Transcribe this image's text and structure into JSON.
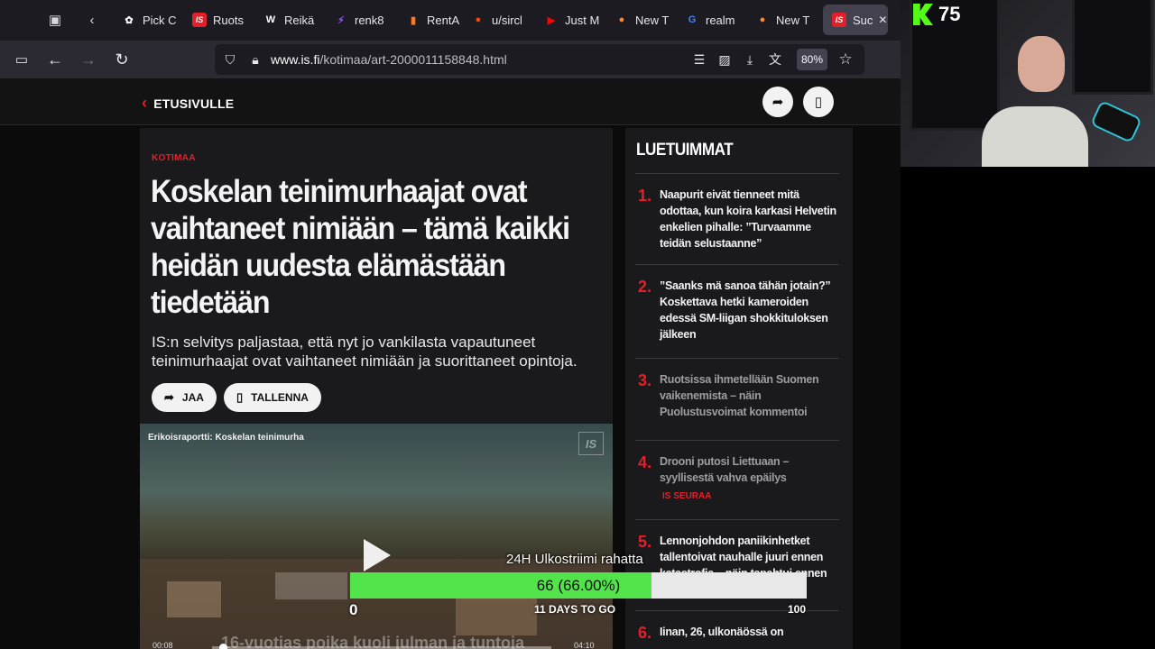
{
  "browser": {
    "tabs": [
      {
        "title": "Pick C",
        "icon": "flower-icon",
        "color": "#ffffff"
      },
      {
        "title": "Ruots",
        "icon": "is-logo-icon",
        "color": "#e3202a"
      },
      {
        "title": "Reikä",
        "icon": "wikipedia-icon",
        "color": "#ffffff"
      },
      {
        "title": "renk8",
        "icon": "bolt-icon",
        "color": "#9b4dff"
      },
      {
        "title": "RentA",
        "icon": "bar-icon",
        "color": "#ff7a1a"
      },
      {
        "title": "u/sircl",
        "icon": "reddit-icon",
        "color": "#ff4500"
      },
      {
        "title": "Just M",
        "icon": "youtube-icon",
        "color": "#ff0000"
      },
      {
        "title": "New T",
        "icon": "firefox-icon",
        "color": "#ff8a2a"
      },
      {
        "title": "realm",
        "icon": "google-icon",
        "color": "#4285f4"
      },
      {
        "title": "New T",
        "icon": "firefox-icon",
        "color": "#ff8a2a"
      },
      {
        "title": "Suc",
        "icon": "is-logo-icon",
        "color": "#e3202a",
        "active": true
      }
    ],
    "url_domain": "www.is.fi",
    "url_path": "/kotimaa/art-2000011158848.html",
    "zoom": "80%"
  },
  "page": {
    "back_label": "ETUSIVULLE",
    "category": "KOTIMAA",
    "headline": "Koskelan teinimurhaajat ovat vaihtaneet nimiään – tämä kaikki heidän uudesta elämästään tiedetään",
    "lead": "IS:n selvitys paljastaa, että nyt jo vankilasta vapautuneet teinimurhaajat ovat vaihtaneet nimiään ja suorittaneet opintoja.",
    "share_label": "JAA",
    "save_label": "TALLENNA",
    "video": {
      "title": "Erikoisraportti: Koskelan teinimurha",
      "logo": "IS",
      "subtitle": "16-vuotias poika kuoli julman ja tuntoja",
      "time_elapsed": "00:08",
      "time_total": "04:10",
      "progress": 0.02
    }
  },
  "most_read": {
    "title": "LUETUIMMAT",
    "items": [
      {
        "num": "1.",
        "text": "Naapurit eivät tienneet mitä odottaa, kun koira karkasi Helvetin enkelien pihalle: ”Turvaamme teidän selustaanne”"
      },
      {
        "num": "2.",
        "text": "”Saanks mä sanoa tähän jotain?” Koskettava hetki kameroiden edessä SM-liigan shokkituloksen jälkeen"
      },
      {
        "num": "3.",
        "text": "Ruotsissa ihmetellään Suomen vaikenemista – näin Puolustusvoimat kommentoi"
      },
      {
        "num": "4.",
        "text": "Drooni putosi Liettuaan – syyllisestä vahva epäilys",
        "tag": "IS SEURAA"
      },
      {
        "num": "5.",
        "text": "Lennonjohdon paniikinhetket tallentoivat nauhalle juuri ennen katastrofia – näin tapahtui ennen putoamista"
      },
      {
        "num": "6.",
        "text": "Iinan, 26, ulkonäössä on"
      }
    ]
  },
  "stream": {
    "viewers": "75",
    "goal_label": "24H Ulkostriimi rahatta",
    "goal_value_text": "66 (66.00%)",
    "goal_progress": 0.66,
    "goal_min": "0",
    "goal_max": "100",
    "goal_days": "11 DAYS TO GO"
  }
}
